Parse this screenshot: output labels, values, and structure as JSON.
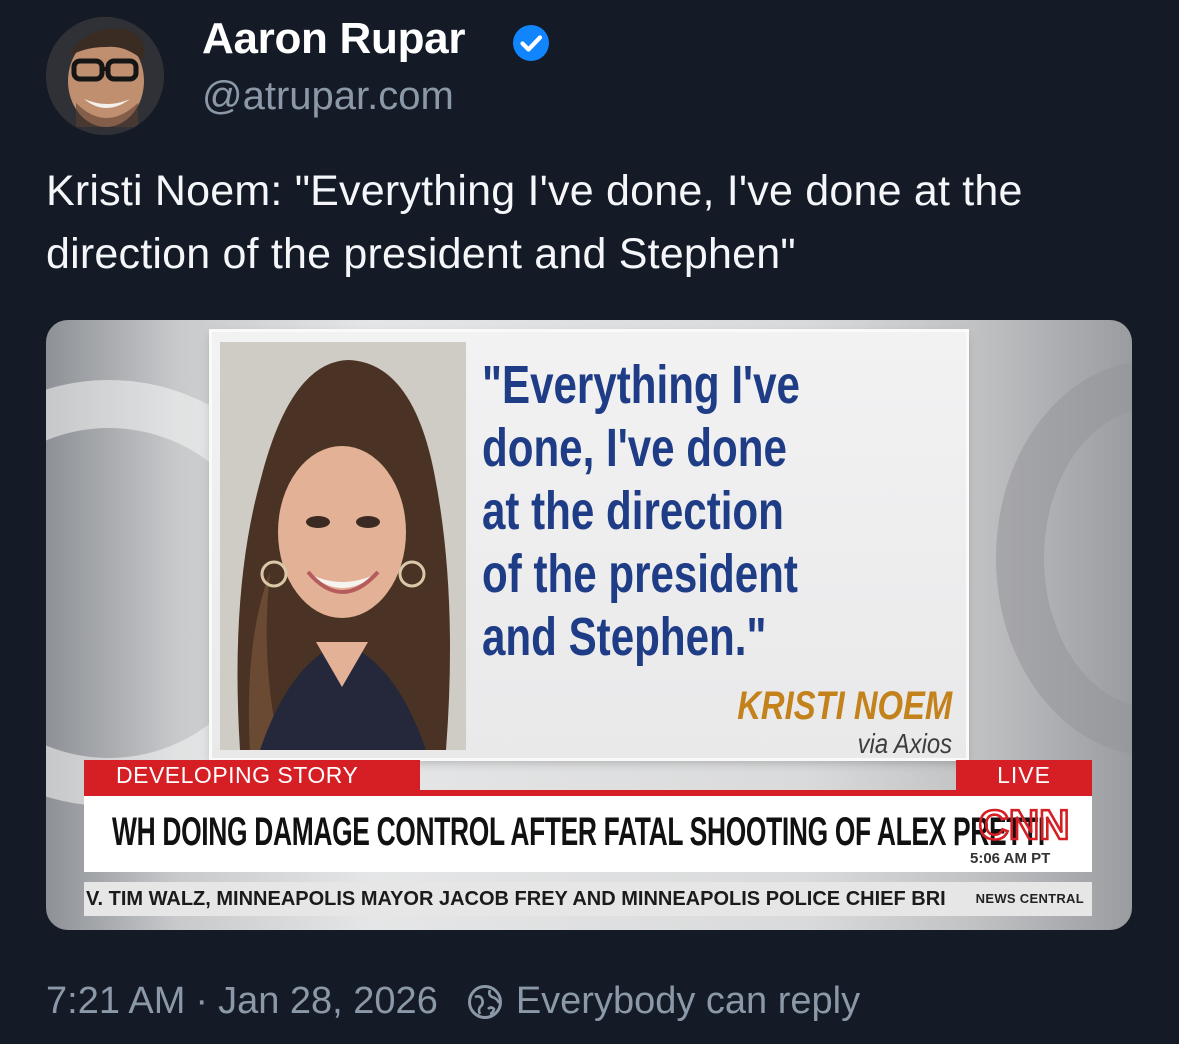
{
  "author": {
    "display_name": "Aaron Rupar",
    "handle": "@atrupar.com",
    "verified": true
  },
  "post": {
    "text": "Kristi Noem: \"Everything I've done, I've done at the direction of the president and Stephen\""
  },
  "media": {
    "quote_lines": [
      "\"Everything I've",
      "done, I've done",
      "at the direction",
      "of the president",
      "and Stephen.\""
    ],
    "quote_name": "KRISTI NOEM",
    "quote_source": "via Axios",
    "developing_label": "DEVELOPING STORY",
    "live_label": "LIVE",
    "headline": "WH DOING DAMAGE CONTROL AFTER FATAL SHOOTING OF ALEX PRETTI",
    "logo_text": "CNN",
    "timestamp": "5:06 AM PT",
    "ticker": "V. TIM WALZ, MINNEAPOLIS MAYOR JACOB FREY AND MINNEAPOLIS POLICE CHIEF BRI",
    "network_label": "NEWS CENTRAL"
  },
  "meta": {
    "time": "7:21 AM",
    "separator": "·",
    "date": "Jan 28, 2026",
    "reply_setting": "Everybody can reply"
  },
  "colors": {
    "background": "#151b26",
    "verified": "#1185fe",
    "quote_blue": "#1f3d86",
    "cnn_red": "#d51f24",
    "name_gold": "#c3821b"
  }
}
